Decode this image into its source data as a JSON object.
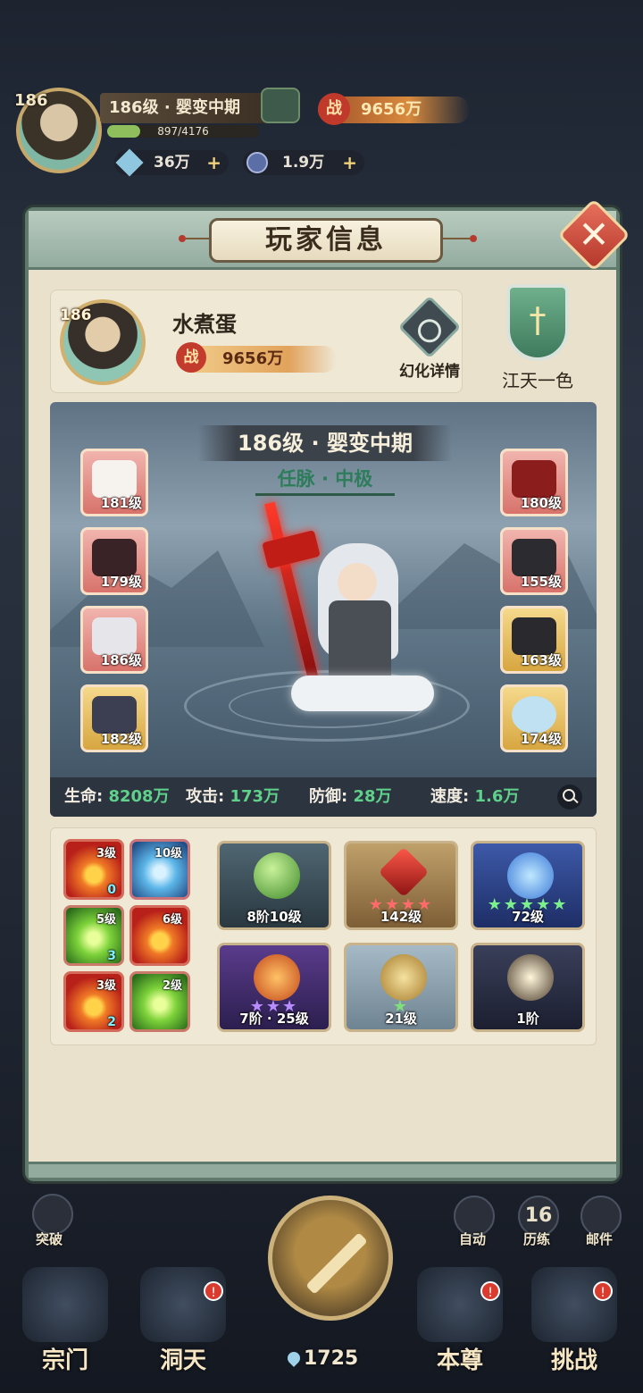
{
  "hud": {
    "level": "186",
    "realm": "186级 · 婴变中期",
    "exp_text": "897/4176",
    "exp_fraction": 0.215,
    "power_badge": "战",
    "power": "9656万",
    "spirit_stones": "36万",
    "coins": "1.9万",
    "plus": "+"
  },
  "dialog": {
    "title": "玩家信息",
    "close": "✕"
  },
  "profile": {
    "level": "186",
    "name": "水煮蛋",
    "power_badge": "战",
    "power": "9656万",
    "illusion_label": "幻化详情",
    "guild_name": "江天一色"
  },
  "stage": {
    "realm": "186级 · 婴变中期",
    "meridian": "任脉 · 中极",
    "left_equipment": [
      {
        "level": "181级",
        "rarity": "red"
      },
      {
        "level": "179级",
        "rarity": "red"
      },
      {
        "level": "186级",
        "rarity": "red"
      },
      {
        "level": "182级",
        "rarity": "gold"
      }
    ],
    "right_equipment": [
      {
        "level": "180级",
        "rarity": "red"
      },
      {
        "level": "155级",
        "rarity": "red"
      },
      {
        "level": "163级",
        "rarity": "gold"
      },
      {
        "level": "174级",
        "rarity": "gold"
      }
    ],
    "stats": {
      "hp_label": "生命:",
      "hp": "8208万",
      "atk_label": "攻击:",
      "atk": "173万",
      "def_label": "防御:",
      "def": "28万",
      "spd_label": "速度:",
      "spd": "1.6万"
    }
  },
  "skills": [
    {
      "level": "3级",
      "count": "0",
      "element": "fire"
    },
    {
      "level": "10级",
      "count": "",
      "element": "water"
    },
    {
      "level": "5级",
      "count": "3",
      "element": "wind"
    },
    {
      "level": "6级",
      "count": "",
      "element": "fire"
    },
    {
      "level": "3级",
      "count": "2",
      "element": "fire"
    },
    {
      "level": "2级",
      "count": "",
      "element": "wind"
    }
  ],
  "cards": [
    {
      "label": "8阶10级",
      "stars": "",
      "stars_count": 0,
      "theme": "stage"
    },
    {
      "label": "142级",
      "stars": "★★★★",
      "stars_count": 4,
      "theme": "temple"
    },
    {
      "label": "72级",
      "stars": "★★★★★",
      "stars_count": 5,
      "theme": "storm"
    },
    {
      "label": "7阶 · 25级",
      "stars": "★★★",
      "stars_count": 3,
      "theme": "fire"
    },
    {
      "label": "21级",
      "stars": "★",
      "stars_count": 1,
      "theme": "pale"
    },
    {
      "label": "1阶",
      "stars": "",
      "stars_count": 0,
      "theme": "dark"
    }
  ],
  "bottom_nav": {
    "breakthrough": "突破",
    "auto": "自动",
    "trial_count": "16",
    "trial": "历练",
    "mail": "邮件",
    "sect": "宗门",
    "cave": "洞天",
    "self": "本尊",
    "challenge": "挑战",
    "main_count": "1725",
    "badge": "!"
  },
  "colors": {
    "panel": "#e9e1cc",
    "frame": "#5f7a6c",
    "stat_value": "#5fd18a",
    "red_rarity": "#d8736b",
    "gold_rarity": "#d7a640"
  }
}
